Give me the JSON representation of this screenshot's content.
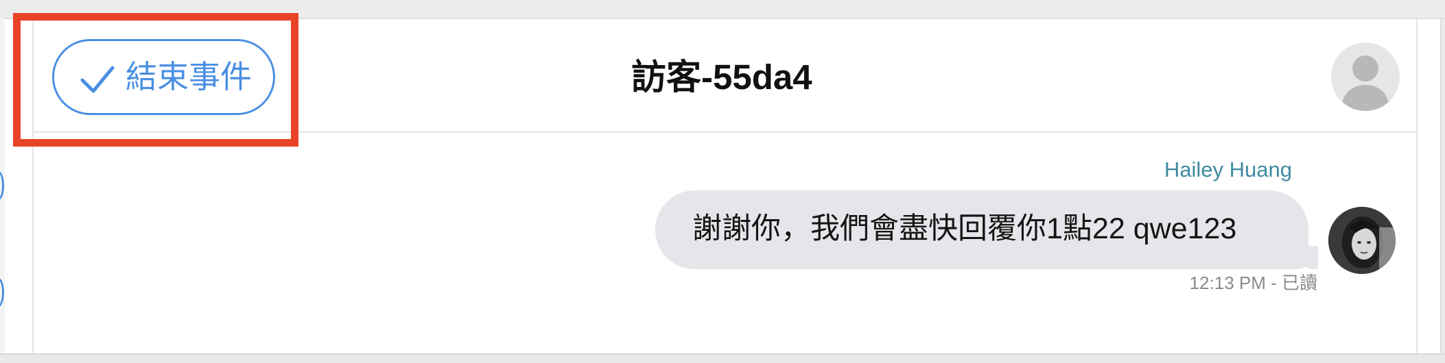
{
  "header": {
    "resolve_button_label": "結束事件",
    "title": "訪客-55da4"
  },
  "message": {
    "sender": "Hailey Huang",
    "text": "謝謝你，我們會盡快回覆你1點22 qwe123",
    "meta": "12:13 PM - 已讀"
  },
  "colors": {
    "accent": "#4a8fe3",
    "highlight": "#e84327",
    "sender_name": "#3f8aa0",
    "bubble": "#e5e5ea"
  },
  "icons": {
    "resolve": "check-icon",
    "visitor_avatar": "user-silhouette-icon",
    "agent_avatar": "agent-photo-avatar"
  }
}
